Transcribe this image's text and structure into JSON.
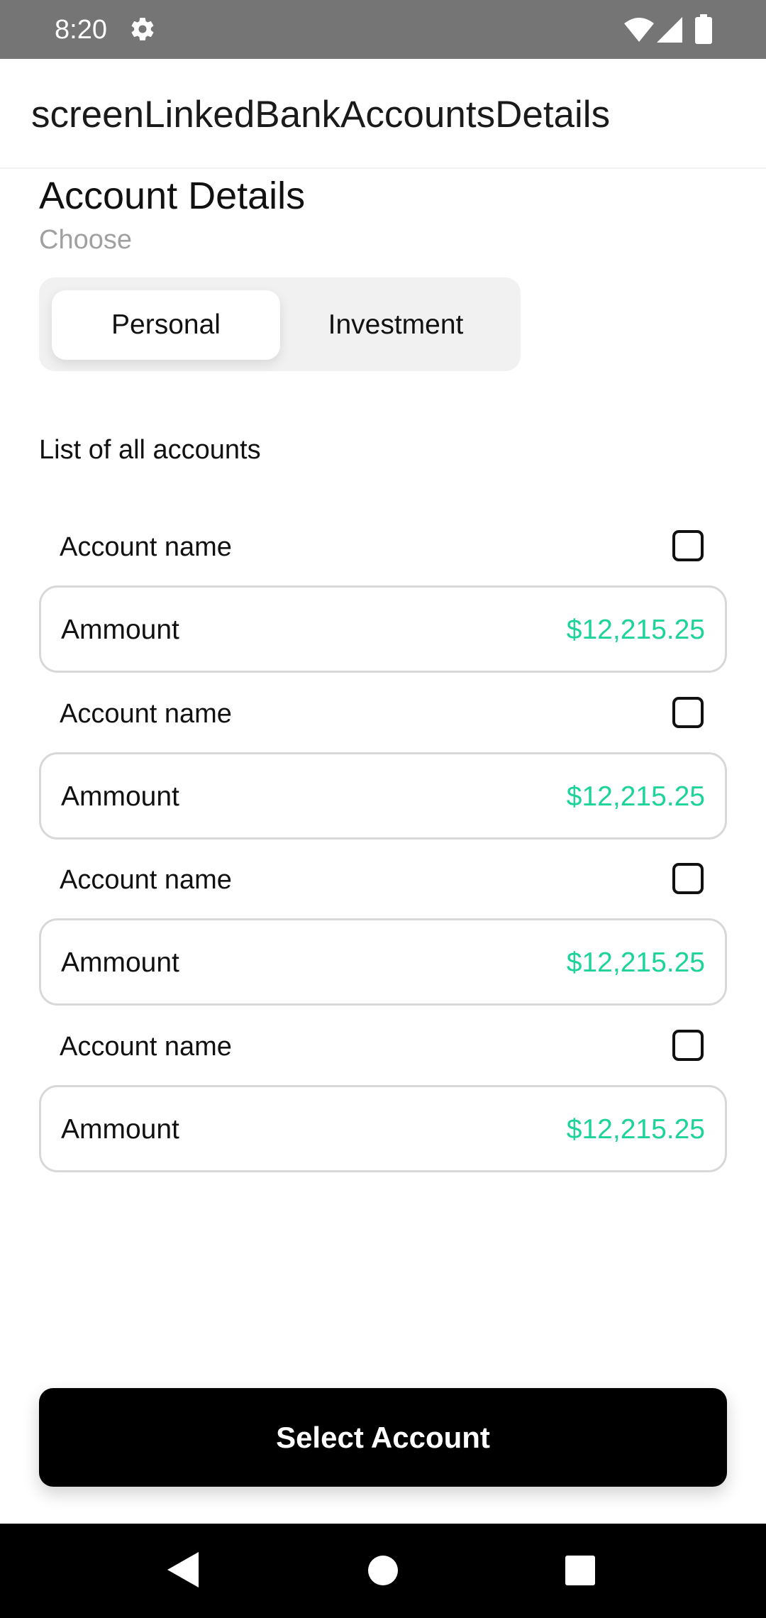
{
  "status_bar": {
    "time": "8:20",
    "icons": [
      "gear-icon",
      "wifi-icon",
      "signal-icon",
      "battery-icon"
    ]
  },
  "app_bar": {
    "title": "screenLinkedBankAccountsDetails"
  },
  "header": {
    "title": "Account Details",
    "subtitle": "Choose"
  },
  "segmented": {
    "options": [
      {
        "label": "Personal",
        "selected": true
      },
      {
        "label": "Investment",
        "selected": false
      }
    ]
  },
  "list": {
    "heading": "List of all accounts",
    "accounts": [
      {
        "name": "Account name",
        "amount_label": "Ammount",
        "amount_value": "$12,215.25",
        "checked": false
      },
      {
        "name": "Account name",
        "amount_label": "Ammount",
        "amount_value": "$12,215.25",
        "checked": false
      },
      {
        "name": "Account name",
        "amount_label": "Ammount",
        "amount_value": "$12,215.25",
        "checked": false
      },
      {
        "name": "Account name",
        "amount_label": "Ammount",
        "amount_value": "$12,215.25",
        "checked": false
      }
    ]
  },
  "primary_button": {
    "label": "Select Account"
  },
  "colors": {
    "amount": "#1ed39a",
    "button_bg": "#000000",
    "status_bar_bg": "#757575"
  },
  "nav_bar": {
    "icons": [
      "back-icon",
      "home-icon",
      "recent-apps-icon"
    ]
  }
}
